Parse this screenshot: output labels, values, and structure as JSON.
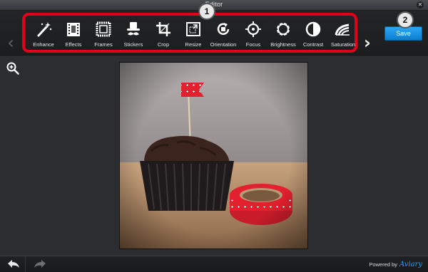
{
  "window": {
    "title": "Editor"
  },
  "toolbar": {
    "tools": [
      {
        "label": "Enhance",
        "icon": "magic-wand-icon"
      },
      {
        "label": "Effects",
        "icon": "film-icon"
      },
      {
        "label": "Frames",
        "icon": "frame-icon"
      },
      {
        "label": "Stickers",
        "icon": "hat-mustache-icon"
      },
      {
        "label": "Crop",
        "icon": "crop-icon"
      },
      {
        "label": "Resize",
        "icon": "resize-icon"
      },
      {
        "label": "Orientation",
        "icon": "rotate-icon"
      },
      {
        "label": "Focus",
        "icon": "focus-icon"
      },
      {
        "label": "Brightness",
        "icon": "sun-icon"
      },
      {
        "label": "Contrast",
        "icon": "contrast-icon"
      },
      {
        "label": "Saturation",
        "icon": "saturation-icon"
      }
    ],
    "save_label": "Save"
  },
  "callouts": {
    "one": "1",
    "two": "2"
  },
  "footer": {
    "powered_by": "Powered by",
    "brand": "Aviary"
  },
  "colors": {
    "accent": "#1b93e6",
    "highlight": "#e2001a",
    "background": "#2b2d30"
  }
}
